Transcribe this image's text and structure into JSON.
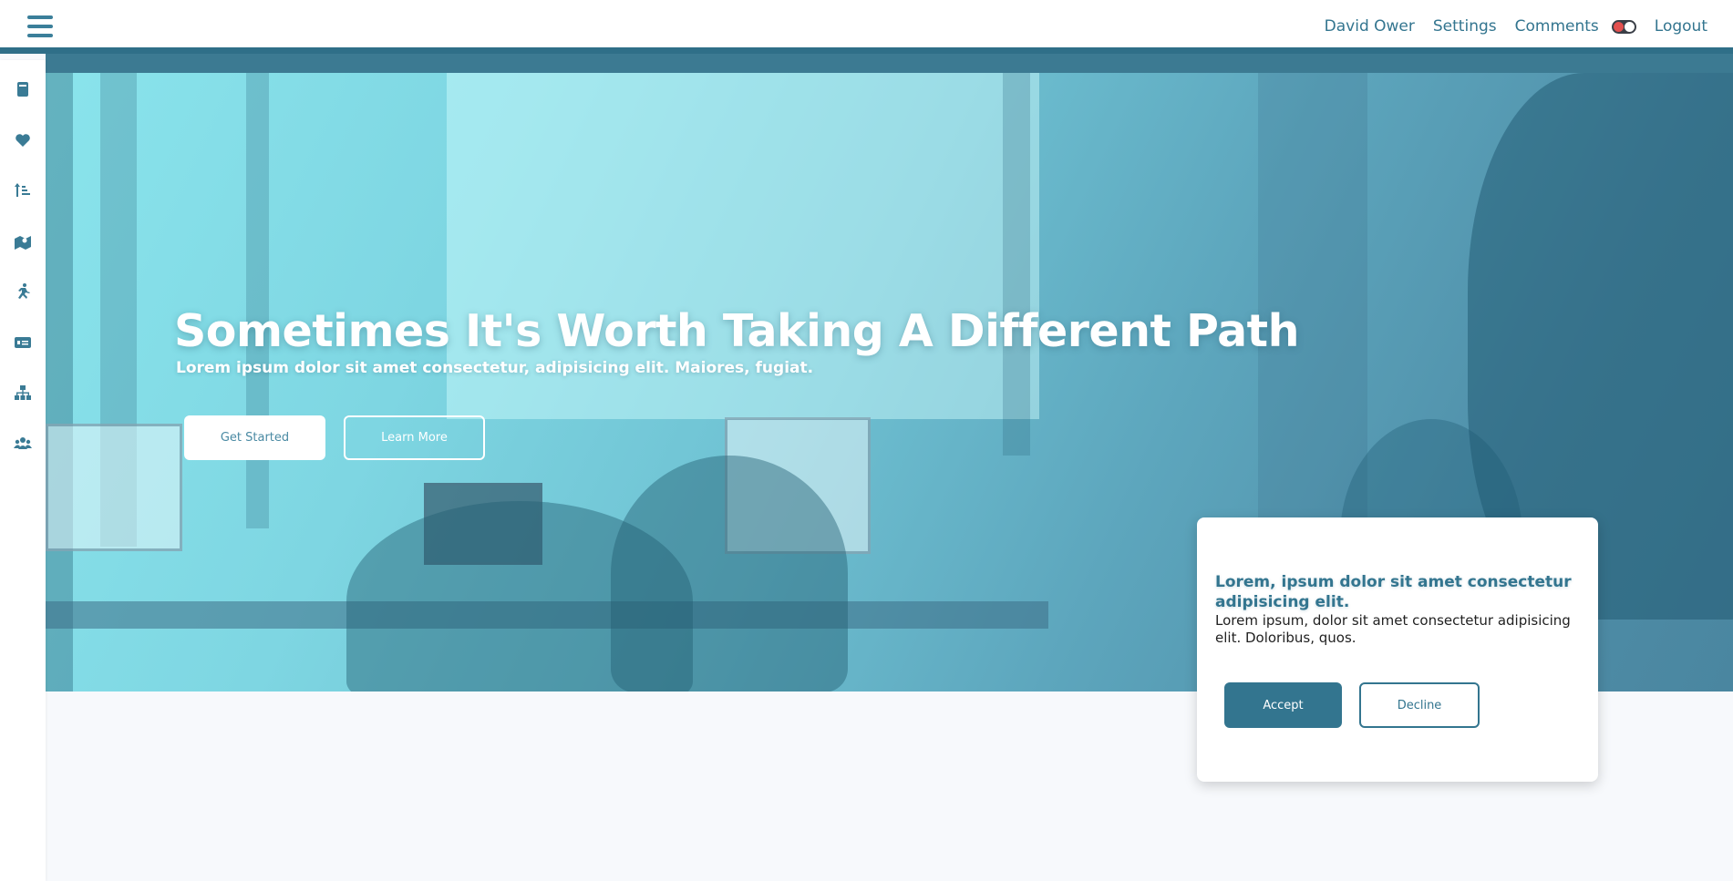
{
  "header": {
    "menu_icon": "hamburger-menu-icon",
    "nav": {
      "user": "David Ower",
      "settings": "Settings",
      "comments": "Comments",
      "logout": "Logout"
    },
    "toggle_icon": "toggle-switch-icon"
  },
  "sidebar": {
    "items": [
      {
        "icon": "book-icon"
      },
      {
        "icon": "heart-icon"
      },
      {
        "icon": "sort-list-icon"
      },
      {
        "icon": "map-marker-icon"
      },
      {
        "icon": "running-person-icon"
      },
      {
        "icon": "money-card-icon"
      },
      {
        "icon": "network-icon"
      },
      {
        "icon": "users-group-icon"
      }
    ]
  },
  "hero": {
    "title": "Sometimes It's Worth Taking A Different Path",
    "subtitle": "Lorem ipsum dolor sit amet consectetur, adipisicing elit. Maiores, fugiat.",
    "primary_button": "Get Started",
    "secondary_button": "Learn More"
  },
  "consent_card": {
    "title": "Lorem, ipsum dolor sit amet consectetur adipisicing elit.",
    "text": "Lorem ipsum, dolor sit amet consectetur adipisicing elit. Doloribus, quos.",
    "accept": "Accept",
    "decline": "Decline"
  },
  "colors": {
    "accent": "#33758f",
    "header_band": "#2f6f88",
    "page_background": "#f7f9fc"
  }
}
